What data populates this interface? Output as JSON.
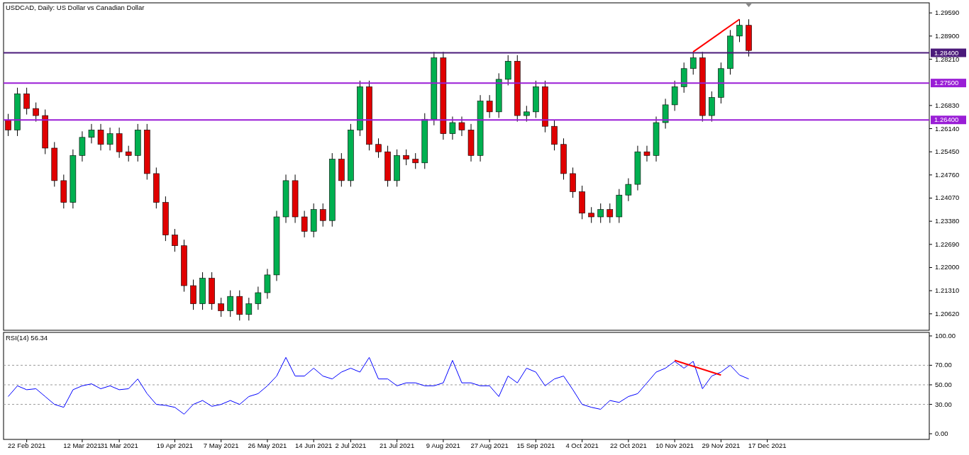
{
  "title": "USDCAD, Daily:  US Dollar vs Canadian Dollar",
  "price_chart": {
    "chart_data": {
      "type": "candlestick",
      "ylim": [
        1.2013,
        1.2989
      ],
      "categories": [
        null,
        null,
        null,
        null,
        null,
        null,
        null,
        null,
        null,
        null,
        null,
        null,
        null,
        null,
        null,
        null,
        null,
        null,
        null,
        null,
        null,
        null,
        null,
        null,
        null,
        null,
        null,
        null,
        null,
        null,
        null,
        null,
        null,
        null,
        null,
        null,
        null,
        null,
        null,
        null,
        null,
        null,
        null,
        null,
        null,
        null,
        null,
        null,
        null,
        null,
        null,
        null,
        null,
        null,
        null,
        null,
        null,
        null,
        null,
        null,
        null,
        null,
        null,
        null,
        null,
        null,
        null,
        null,
        null,
        null,
        null,
        null,
        null,
        null,
        null,
        null,
        null,
        null,
        null,
        null,
        null,
        null,
        null,
        null,
        null,
        null,
        null,
        null,
        null,
        null,
        null,
        null,
        null,
        null,
        null,
        null,
        null,
        null,
        null,
        null
      ],
      "ohlc": [
        [
          1.264,
          1.2658,
          1.2592,
          1.261
        ],
        [
          1.261,
          1.2736,
          1.2592,
          1.2718
        ],
        [
          1.2718,
          1.2736,
          1.2656,
          1.2674
        ],
        [
          1.2674,
          1.2692,
          1.2635,
          1.2653
        ],
        [
          1.2653,
          1.2671,
          1.2538,
          1.2556
        ],
        [
          1.2556,
          1.2574,
          1.2441,
          1.2459
        ],
        [
          1.2459,
          1.2477,
          1.2376,
          1.2394
        ],
        [
          1.2394,
          1.2552,
          1.2376,
          1.2534
        ],
        [
          1.2534,
          1.2606,
          1.2516,
          1.2588
        ],
        [
          1.2588,
          1.2628,
          1.257,
          1.261
        ],
        [
          1.261,
          1.2628,
          1.2549,
          1.2567
        ],
        [
          1.2567,
          1.2617,
          1.2549,
          1.2599
        ],
        [
          1.2599,
          1.2617,
          1.2527,
          1.2545
        ],
        [
          1.2545,
          1.2563,
          1.2516,
          1.2534
        ],
        [
          1.2534,
          1.2628,
          1.2516,
          1.261
        ],
        [
          1.261,
          1.2628,
          1.2462,
          1.248
        ],
        [
          1.248,
          1.2498,
          1.2376,
          1.2394
        ],
        [
          1.2394,
          1.2412,
          1.2279,
          1.2297
        ],
        [
          1.2297,
          1.2315,
          1.2247,
          1.2265
        ],
        [
          1.2265,
          1.2283,
          1.2128,
          1.2146
        ],
        [
          1.2146,
          1.2164,
          1.2074,
          1.2092
        ],
        [
          1.2092,
          1.2186,
          1.2074,
          1.2168
        ],
        [
          1.2168,
          1.2186,
          1.2074,
          1.2092
        ],
        [
          1.2092,
          1.211,
          1.2053,
          1.2071
        ],
        [
          1.2071,
          1.2132,
          1.2053,
          1.2114
        ],
        [
          1.2114,
          1.2132,
          1.2042,
          1.206
        ],
        [
          1.206,
          1.211,
          1.2042,
          1.2092
        ],
        [
          1.2092,
          1.2143,
          1.2074,
          1.2125
        ],
        [
          1.2125,
          1.2196,
          1.2107,
          1.2178
        ],
        [
          1.2178,
          1.2369,
          1.216,
          1.2351
        ],
        [
          1.2351,
          1.2477,
          1.2333,
          1.2459
        ],
        [
          1.2459,
          1.2477,
          1.2333,
          1.2351
        ],
        [
          1.2351,
          1.2369,
          1.229,
          1.2308
        ],
        [
          1.2308,
          1.2391,
          1.229,
          1.2373
        ],
        [
          1.2373,
          1.2391,
          1.2322,
          1.234
        ],
        [
          1.234,
          1.2541,
          1.2322,
          1.2523
        ],
        [
          1.2523,
          1.2541,
          1.2441,
          1.2459
        ],
        [
          1.2459,
          1.2628,
          1.2441,
          1.261
        ],
        [
          1.261,
          1.2757,
          1.2592,
          1.2739
        ],
        [
          1.2739,
          1.2757,
          1.2549,
          1.2567
        ],
        [
          1.2567,
          1.2585,
          1.2527,
          1.2545
        ],
        [
          1.2545,
          1.2563,
          1.2441,
          1.2459
        ],
        [
          1.2459,
          1.2552,
          1.2441,
          1.2534
        ],
        [
          1.2534,
          1.2552,
          1.2505,
          1.2523
        ],
        [
          1.2523,
          1.2541,
          1.2494,
          1.2512
        ],
        [
          1.2512,
          1.266,
          1.2494,
          1.2642
        ],
        [
          1.2642,
          1.2843,
          1.2624,
          1.2825
        ],
        [
          1.2825,
          1.2843,
          1.2581,
          1.2599
        ],
        [
          1.2599,
          1.265,
          1.2581,
          1.2632
        ],
        [
          1.2632,
          1.265,
          1.2592,
          1.261
        ],
        [
          1.261,
          1.2628,
          1.2516,
          1.2534
        ],
        [
          1.2534,
          1.2714,
          1.2516,
          1.2696
        ],
        [
          1.2696,
          1.2714,
          1.2646,
          1.2664
        ],
        [
          1.2664,
          1.2779,
          1.2646,
          1.2761
        ],
        [
          1.2761,
          1.2833,
          1.2743,
          1.2815
        ],
        [
          1.2815,
          1.2833,
          1.2635,
          1.2653
        ],
        [
          1.2653,
          1.2682,
          1.2635,
          1.2664
        ],
        [
          1.2664,
          1.2757,
          1.2646,
          1.2739
        ],
        [
          1.2739,
          1.2757,
          1.2603,
          1.2621
        ],
        [
          1.2621,
          1.2639,
          1.2549,
          1.2567
        ],
        [
          1.2567,
          1.2585,
          1.2462,
          1.248
        ],
        [
          1.248,
          1.2498,
          1.2408,
          1.2426
        ],
        [
          1.2426,
          1.2444,
          1.2344,
          1.2362
        ],
        [
          1.2362,
          1.238,
          1.2333,
          1.2351
        ],
        [
          1.2351,
          1.2391,
          1.2333,
          1.2373
        ],
        [
          1.2373,
          1.2391,
          1.2333,
          1.2351
        ],
        [
          1.2351,
          1.2434,
          1.2333,
          1.2416
        ],
        [
          1.2416,
          1.2466,
          1.2398,
          1.2448
        ],
        [
          1.2448,
          1.2563,
          1.243,
          1.2545
        ],
        [
          1.2545,
          1.2563,
          1.2516,
          1.2534
        ],
        [
          1.2534,
          1.265,
          1.2516,
          1.2632
        ],
        [
          1.2632,
          1.2703,
          1.2614,
          1.2685
        ],
        [
          1.2685,
          1.2757,
          1.2667,
          1.2739
        ],
        [
          1.2739,
          1.2811,
          1.2721,
          1.2793
        ],
        [
          1.2793,
          1.2843,
          1.2775,
          1.2825
        ],
        [
          1.2825,
          1.2843,
          1.2635,
          1.2653
        ],
        [
          1.2653,
          1.2725,
          1.2635,
          1.2707
        ],
        [
          1.2707,
          1.2811,
          1.2689,
          1.2793
        ],
        [
          1.2793,
          1.2908,
          1.2775,
          1.289
        ],
        [
          1.289,
          1.294,
          1.2872,
          1.2922
        ],
        [
          1.2922,
          1.294,
          1.2829,
          1.2847
        ],
        null,
        null,
        null,
        null,
        null,
        null,
        null,
        null,
        null,
        null,
        null,
        null,
        null,
        null,
        null,
        null,
        null,
        null,
        null
      ],
      "yticks": [
        {
          "value": 1.2959,
          "label": "1.29590"
        },
        {
          "value": 1.289,
          "label": "1.28900"
        },
        {
          "value": 1.2821,
          "label": "1.28210"
        },
        {
          "value": 1.2683,
          "label": "1.26830"
        },
        {
          "value": 1.2614,
          "label": "1.26140"
        },
        {
          "value": 1.2545,
          "label": "1.25450"
        },
        {
          "value": 1.2476,
          "label": "1.24760"
        },
        {
          "value": 1.2407,
          "label": "1.24070"
        },
        {
          "value": 1.2338,
          "label": "1.23380"
        },
        {
          "value": 1.2269,
          "label": "1.22690"
        },
        {
          "value": 1.22,
          "label": "1.22000"
        },
        {
          "value": 1.2131,
          "label": "1.21310"
        },
        {
          "value": 1.2062,
          "label": "1.20620"
        }
      ],
      "ref_lines": [
        {
          "axis": "y",
          "value": 1.284,
          "label": "1.28400",
          "color": "#4b1a7a"
        },
        {
          "axis": "y",
          "value": 1.275,
          "label": "1.27500",
          "color": "#9a1ed6"
        },
        {
          "axis": "y",
          "value": 1.264,
          "label": "1.26400",
          "color": "#9a1ed6"
        }
      ]
    }
  },
  "rsi_chart": {
    "value": "56.34",
    "chart_data": {
      "type": "line",
      "ylim": [
        -5.8,
        103.6
      ],
      "grid": true,
      "categories": [
        null,
        null,
        "22 Feb 2021",
        null,
        null,
        null,
        null,
        null,
        "12 Mar 2021",
        null,
        null,
        null,
        "31 Mar 2021",
        null,
        null,
        null,
        null,
        null,
        "19 Apr 2021",
        null,
        null,
        null,
        null,
        "7 May 2021",
        null,
        null,
        null,
        null,
        "26 May 2021",
        null,
        null,
        null,
        null,
        "14 Jun 2021",
        null,
        null,
        null,
        "2 Jul 2021",
        null,
        null,
        null,
        null,
        "21 Jul 2021",
        null,
        null,
        null,
        null,
        "9 Aug 2021",
        null,
        null,
        null,
        null,
        "27 Aug 2021",
        null,
        null,
        null,
        null,
        "15 Sep 2021",
        null,
        null,
        null,
        null,
        "4 Oct 2021",
        null,
        null,
        null,
        null,
        "22 Oct 2021",
        null,
        null,
        null,
        null,
        "10 Nov 2021",
        null,
        null,
        null,
        null,
        "29 Nov 2021",
        null,
        null,
        null,
        null,
        "17 Dec 2021",
        null,
        null,
        null,
        null,
        null,
        null,
        null,
        null,
        null,
        null,
        null,
        null,
        null,
        null,
        null,
        null,
        null
      ],
      "series": [
        {
          "name": "RSI(14)",
          "color": "#0000ff",
          "values": [
            38,
            49,
            45,
            46,
            38,
            30,
            27,
            45,
            49,
            51,
            46,
            49,
            45,
            46,
            56,
            41,
            30,
            29,
            27,
            20,
            30,
            34,
            28,
            30,
            34,
            30,
            38,
            41,
            49,
            59,
            78,
            59,
            59,
            67,
            59,
            56,
            63,
            67,
            63,
            78,
            56,
            56,
            49,
            52,
            52,
            49,
            49,
            52,
            75,
            52,
            52,
            49,
            49,
            38,
            59,
            52,
            67,
            63,
            49,
            56,
            59,
            45,
            30,
            27,
            25,
            34,
            32,
            38,
            41,
            52,
            63,
            67,
            74,
            67,
            74,
            46,
            59,
            63,
            70,
            60,
            56,
            null,
            null,
            null,
            null,
            null,
            null,
            null,
            null,
            null,
            null,
            null,
            null,
            null,
            null,
            null,
            null,
            null,
            null,
            null
          ]
        }
      ],
      "yticks": [
        {
          "value": 100,
          "label": "100.00"
        },
        {
          "value": 70,
          "label": "70.00"
        },
        {
          "value": 50,
          "label": "50.00"
        },
        {
          "value": 30,
          "label": "30.00"
        },
        {
          "value": 0,
          "label": "0.00"
        }
      ]
    }
  }
}
